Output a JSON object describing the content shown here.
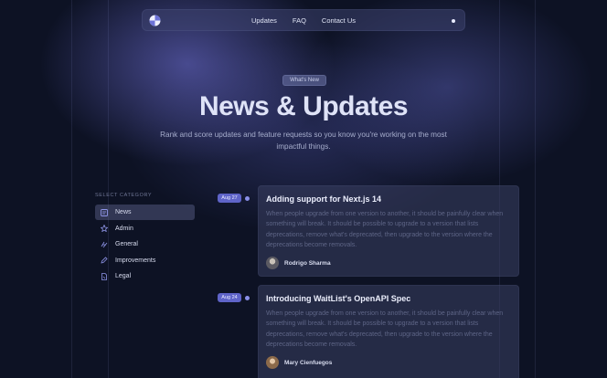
{
  "nav": {
    "links": [
      "Updates",
      "FAQ",
      "Contact Us"
    ]
  },
  "hero": {
    "badge": "What's New",
    "title": "News & Updates",
    "subtitle": "Rank and score updates and feature requests so you know you're working on the most impactful things."
  },
  "categories": {
    "heading": "SELECT CATEGORY",
    "items": [
      {
        "label": "News",
        "icon": "news-icon",
        "active": true
      },
      {
        "label": "Admin",
        "icon": "admin-icon",
        "active": false
      },
      {
        "label": "General",
        "icon": "general-icon",
        "active": false
      },
      {
        "label": "Improvements",
        "icon": "improvements-icon",
        "active": false
      },
      {
        "label": "Legal",
        "icon": "legal-icon",
        "active": false
      }
    ]
  },
  "updates": [
    {
      "date": "Aug 27",
      "title": "Adding support for Next.js 14",
      "body": "When people upgrade from one version to another, it should be painfully clear when something will break. It should be possible to upgrade to a version that lists deprecations, remove what's deprecated, then upgrade to the version where the deprecations become removals.",
      "author": "Rodrigo Sharma"
    },
    {
      "date": "Aug 24",
      "title": "Introducing WaitList's OpenAPI Spec",
      "body": "When people upgrade from one version to another, it should be painfully clear when something will break. It should be possible to upgrade to a version that lists deprecations, remove what's deprecated, then upgrade to the version where the deprecations become removals.",
      "author": "Mary Cienfuegos"
    }
  ],
  "colors": {
    "background": "#0d1224",
    "accent": "#5f64c8",
    "card": "#3a3f62"
  }
}
